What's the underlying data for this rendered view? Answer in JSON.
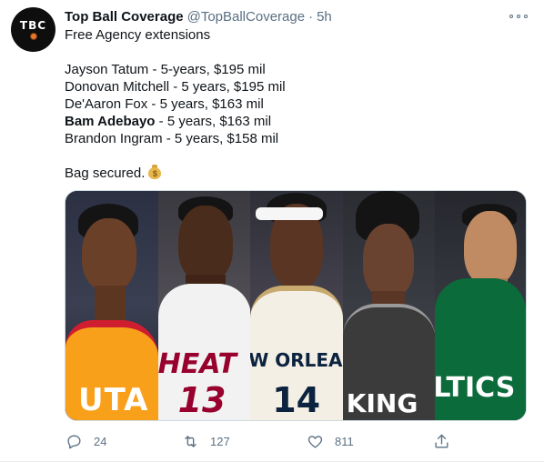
{
  "tweet": {
    "avatar_text": "TBC",
    "display_name": "Top Ball Coverage",
    "handle": "@TopBallCoverage",
    "separator": "·",
    "time": "5h",
    "more_icon": "more-horizontal-icon",
    "lines": {
      "intro": "Free Agency extensions",
      "l1": "Jayson Tatum - 5-years, $195 mil",
      "l2": "Donovan Mitchell - 5 years, $195 mil",
      "l3": "De'Aaron Fox - 5 years, $163 mil",
      "l4_name": "Bam Adebayo",
      "l4_rest": " - 5 years, $163 mil",
      "l5": "Brandon Ingram - 5 years, $158 mil",
      "outro": "Bag secured.",
      "outro_emoji": "money-bag-icon"
    },
    "media": {
      "panels": [
        {
          "jersey_text": "UTA",
          "number": "",
          "jersey_color": "#f9a01b",
          "trim_color": "#cf1e2f"
        },
        {
          "jersey_text": "HEAT",
          "number": "13",
          "jersey_color": "#f2f2f2",
          "trim_color": "#98002e"
        },
        {
          "jersey_text": "W ORLEANS",
          "number": "14",
          "jersey_color": "#f3efe4",
          "trim_color": "#0c2340"
        },
        {
          "jersey_text": "KING",
          "number": "",
          "jersey_color": "#3b3b3b",
          "trim_color": "#ffffff"
        },
        {
          "jersey_text": "LTICS",
          "number": "",
          "jersey_color": "#0b6b3a",
          "trim_color": "#ffffff"
        }
      ]
    },
    "actions": {
      "reply_count": "24",
      "retweet_count": "127",
      "like_count": "811",
      "share_label": ""
    }
  },
  "colors": {
    "text_primary": "#0f1419",
    "text_secondary": "#5b7083",
    "border": "#cfd9de"
  }
}
